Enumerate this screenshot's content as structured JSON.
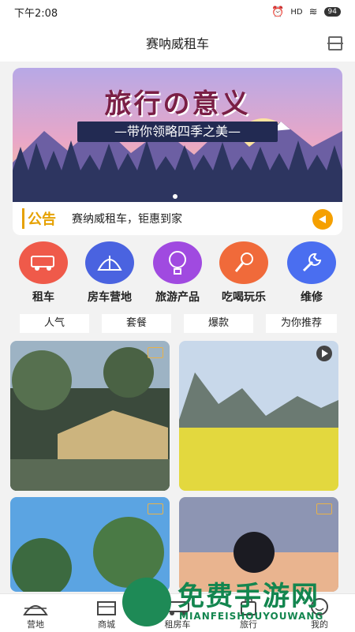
{
  "status": {
    "time": "下午2:08",
    "battery": "94"
  },
  "header": {
    "title": "赛呐威租车"
  },
  "banner": {
    "title": "旅行の意义",
    "subtitle": "—带你领略四季之美—"
  },
  "notice": {
    "tag": "公告",
    "text": "赛纳威租车，钜惠到家"
  },
  "quicknav": [
    {
      "label": "租车",
      "color": "#ef5a4a"
    },
    {
      "label": "房车营地",
      "color": "#4a63e0"
    },
    {
      "label": "旅游产品",
      "color": "#a04ae0"
    },
    {
      "label": "吃喝玩乐",
      "color": "#f06a3a"
    },
    {
      "label": "维修",
      "color": "#4a6ef0"
    }
  ],
  "tags": [
    "人气",
    "套餐",
    "爆款",
    "为你推荐"
  ],
  "cards": [
    {
      "scene": "camp-night",
      "icon": "image-icon"
    },
    {
      "scene": "flower-field",
      "icon": "play-icon"
    },
    {
      "scene": "tree-sky",
      "icon": "image-icon"
    },
    {
      "scene": "portrait-sunset",
      "icon": "image-icon"
    }
  ],
  "tabbar": [
    "营地",
    "商城",
    "租房车",
    "旅行",
    "我的"
  ],
  "watermark": {
    "text": "免费手游网",
    "pinyin": "MIANFEISHOUYOUWANG"
  }
}
